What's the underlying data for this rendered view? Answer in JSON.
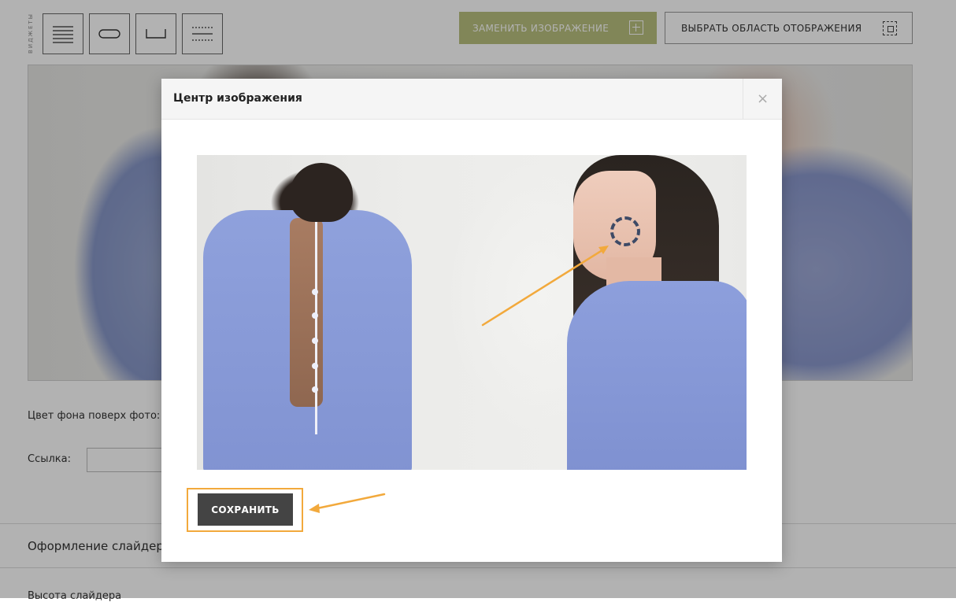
{
  "toolbar": {
    "widgets_label": "ВИДЖЕТЫ",
    "widgets": [
      {
        "icon": "text-lines-icon"
      },
      {
        "icon": "button-shape-icon"
      },
      {
        "icon": "spacer-icon"
      },
      {
        "icon": "divider-icon"
      }
    ],
    "replace_image_label": "ЗАМЕНИТЬ ИЗОБРАЖЕНИЕ",
    "select_area_label": "ВЫБРАТЬ ОБЛАСТЬ ОТОБРАЖЕНИЯ"
  },
  "form": {
    "bg_color_label": "Цвет фона поверх фото:",
    "link_label": "Ссылка:",
    "link_value": ""
  },
  "sections": {
    "slider_design": "Оформление слайдера",
    "slider_height": "Высота слайдера"
  },
  "modal": {
    "title": "Центр изображения",
    "close_symbol": "×",
    "save_label": "СОХРАНИТЬ"
  },
  "colors": {
    "accent_replace": "#b9c17e",
    "highlight": "#f2a93c",
    "save_button": "#444444"
  }
}
